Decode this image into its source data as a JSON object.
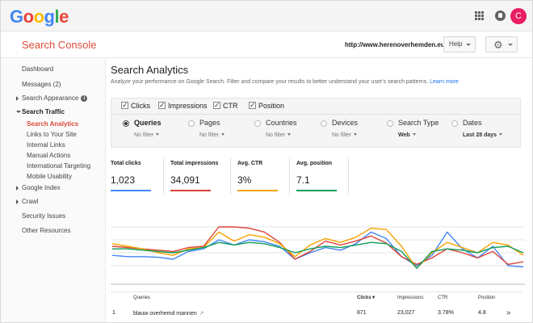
{
  "colors": {
    "clicks": "#4285f4",
    "impressions": "#db4437",
    "ctr": "#f4a300",
    "position": "#0f9d58",
    "brand_red": "#dd4b39",
    "avatar": "#e91e63"
  },
  "topbar": {
    "logo_letters": [
      "G",
      "o",
      "o",
      "g",
      "l",
      "e"
    ],
    "logo_colors": [
      "#4285f4",
      "#ea4335",
      "#fbbc05",
      "#4285f4",
      "#34a853",
      "#ea4335"
    ],
    "avatar_letter": "C"
  },
  "header": {
    "title": "Search Console",
    "site_url": "http://www.herenoverhemden.eu/",
    "help_label": "Help"
  },
  "sidebar": {
    "items": [
      {
        "label": "Dashboard"
      },
      {
        "label": "Messages (2)"
      },
      {
        "label": "Search Appearance"
      },
      {
        "label": "Search Traffic"
      },
      {
        "label": "Search Analytics"
      },
      {
        "label": "Links to Your Site"
      },
      {
        "label": "Internal Links"
      },
      {
        "label": "Manual Actions"
      },
      {
        "label": "International Targeting"
      },
      {
        "label": "Mobile Usability"
      },
      {
        "label": "Google Index"
      },
      {
        "label": "Crawl"
      },
      {
        "label": "Security Issues"
      },
      {
        "label": "Other Resources"
      }
    ]
  },
  "main": {
    "title": "Search Analytics",
    "description": "Analyze your performance on Google Search. Filter and compare your results to better understand your user's search patterns.",
    "learn_more": "Learn more",
    "metrics": [
      {
        "label": "Clicks"
      },
      {
        "label": "Impressions"
      },
      {
        "label": "CTR"
      },
      {
        "label": "Position"
      }
    ],
    "dimensions": [
      {
        "label": "Queries",
        "filter": "No filter",
        "selected": true
      },
      {
        "label": "Pages",
        "filter": "No filter"
      },
      {
        "label": "Countries",
        "filter": "No filter"
      },
      {
        "label": "Devices",
        "filter": "No filter"
      },
      {
        "label": "Search Type",
        "filter": "Web"
      },
      {
        "label": "Dates",
        "filter": "Last 28 days"
      }
    ],
    "cards": [
      {
        "label": "Total clicks",
        "value": "1,023"
      },
      {
        "label": "Total impressions",
        "value": "34,091"
      },
      {
        "label": "Avg. CTR",
        "value": "3%"
      },
      {
        "label": "Avg. position",
        "value": "7.1"
      }
    ]
  },
  "chart_data": {
    "type": "line",
    "title": "",
    "xlabel": "",
    "ylabel": "",
    "ylim": [
      0,
      1
    ],
    "grid": true,
    "legend": "none",
    "x": [
      1,
      2,
      3,
      4,
      5,
      6,
      7,
      8,
      9,
      10,
      11,
      12,
      13,
      14,
      15,
      16,
      17,
      18,
      19,
      20,
      21,
      22,
      23,
      24,
      25,
      26,
      27,
      28
    ],
    "series": [
      {
        "name": "Clicks",
        "color": "#4285f4",
        "values": [
          0.36,
          0.34,
          0.34,
          0.33,
          0.3,
          0.42,
          0.46,
          0.6,
          0.52,
          0.6,
          0.57,
          0.5,
          0.3,
          0.4,
          0.48,
          0.44,
          0.54,
          0.72,
          0.62,
          0.34,
          0.2,
          0.36,
          0.72,
          0.46,
          0.32,
          0.5,
          0.2,
          0.18
        ]
      },
      {
        "name": "Impressions",
        "color": "#db4437",
        "values": [
          0.5,
          0.48,
          0.46,
          0.44,
          0.42,
          0.48,
          0.5,
          0.8,
          0.8,
          0.78,
          0.72,
          0.56,
          0.3,
          0.42,
          0.58,
          0.52,
          0.58,
          0.66,
          0.55,
          0.34,
          0.22,
          0.32,
          0.46,
          0.4,
          0.32,
          0.42,
          0.22,
          0.26
        ]
      },
      {
        "name": "CTR",
        "color": "#f4a300",
        "values": [
          0.54,
          0.5,
          0.46,
          0.4,
          0.36,
          0.46,
          0.48,
          0.72,
          0.58,
          0.68,
          0.64,
          0.54,
          0.34,
          0.52,
          0.62,
          0.56,
          0.64,
          0.78,
          0.76,
          0.5,
          0.16,
          0.4,
          0.56,
          0.48,
          0.4,
          0.56,
          0.52,
          0.36
        ]
      },
      {
        "name": "Position",
        "color": "#0f9d58",
        "values": [
          0.46,
          0.46,
          0.44,
          0.42,
          0.4,
          0.44,
          0.48,
          0.56,
          0.52,
          0.56,
          0.54,
          0.48,
          0.4,
          0.46,
          0.5,
          0.48,
          0.52,
          0.56,
          0.54,
          0.42,
          0.16,
          0.42,
          0.46,
          0.44,
          0.4,
          0.48,
          0.5,
          0.4
        ]
      }
    ]
  },
  "table": {
    "headers": {
      "query": "Queries",
      "clicks": "Clicks▼",
      "impressions": "Impressions",
      "ctr": "CTR",
      "position": "Position"
    },
    "rows": [
      {
        "index": "1",
        "query": "blauw overhemd mannen",
        "clicks": "871",
        "impressions": "23,027",
        "ctr": "3.78%",
        "position": "4.8"
      }
    ]
  }
}
